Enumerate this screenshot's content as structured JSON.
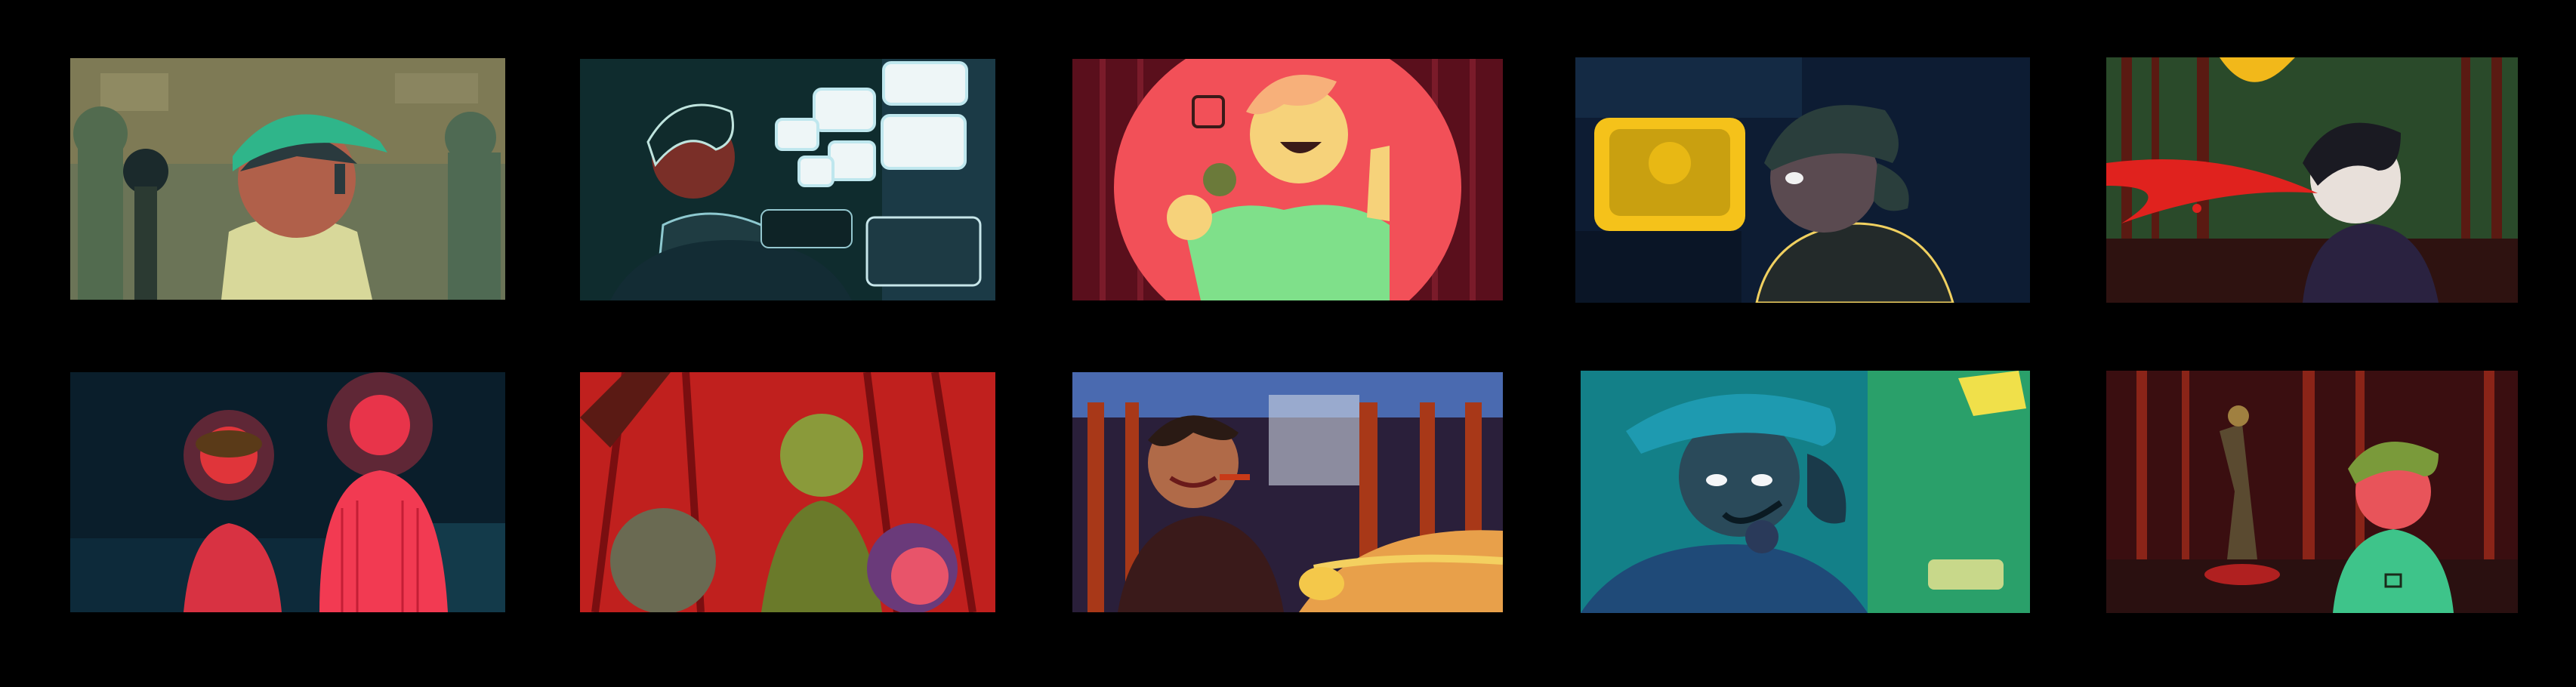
{
  "sheet": {
    "background": "#000000",
    "panel_count": 10,
    "rows": 2,
    "columns": 5
  },
  "panels": [
    {
      "scene": "character-in-green-cap-behind-camera",
      "dominant_color": "#6b7a57",
      "accent": "#2fb58a"
    },
    {
      "scene": "operator-at-control-desk-with-monitors",
      "dominant_color": "#0e2a2b",
      "accent": "#e8f4f5"
    },
    {
      "scene": "singer-with-microphone-spotlight",
      "dominant_color": "#f25058",
      "accent": "#7fe08a"
    },
    {
      "scene": "capped-character-by-glowing-tv",
      "dominant_color": "#0d1c33",
      "accent": "#f5c21a"
    },
    {
      "scene": "blood-splatter-in-forest",
      "dominant_color": "#1f3a1f",
      "accent": "#e0221e"
    },
    {
      "scene": "two-figures-in-red-glow",
      "dominant_color": "#0a1e2b",
      "accent": "#ff3a4a"
    },
    {
      "scene": "group-under-red-trees",
      "dominant_color": "#c0201e",
      "accent": "#7a8a3a"
    },
    {
      "scene": "smiling-man-with-cigar-in-forest",
      "dominant_color": "#2a1f3a",
      "accent": "#e8643a"
    },
    {
      "scene": "capped-character-smoking-blue",
      "dominant_color": "#15848a",
      "accent": "#f0e04a"
    },
    {
      "scene": "figure-in-dark-red-forest",
      "dominant_color": "#3a0e10",
      "accent": "#3ec48a"
    }
  ]
}
